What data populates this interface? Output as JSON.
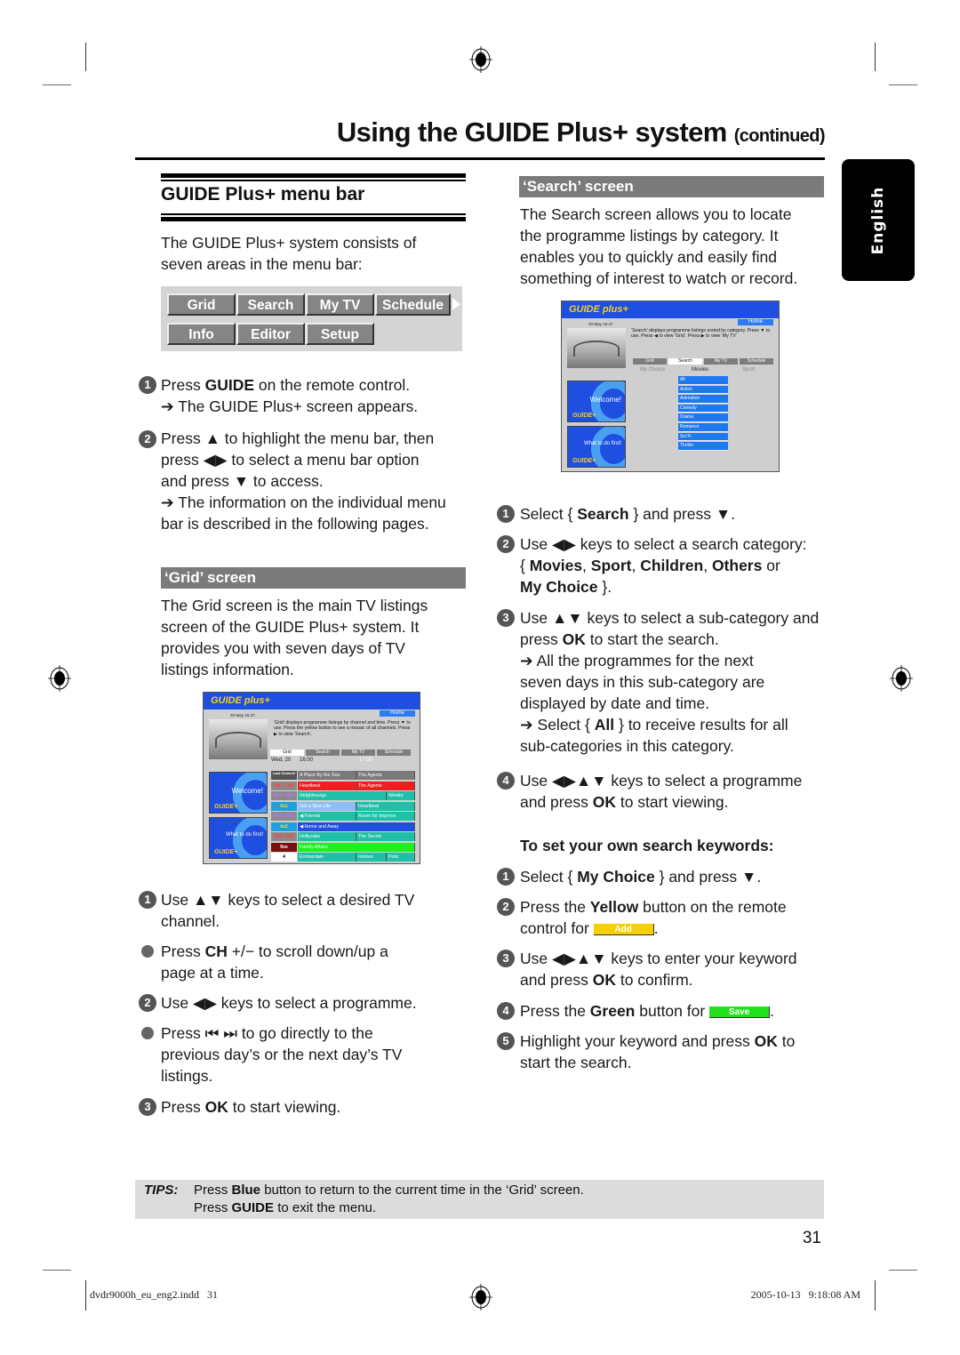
{
  "header": {
    "title": "Using the GUIDE Plus+ system",
    "title_suffix": "(continued)"
  },
  "language_tab": "English",
  "menu_bar_section": {
    "heading": "GUIDE Plus+ menu bar",
    "intro": "The GUIDE Plus+ system consists of seven areas in the menu bar:",
    "menu_buttons_row1": [
      "Grid",
      "Search",
      "My TV",
      "Schedule"
    ],
    "menu_buttons_row2": [
      "Info",
      "Editor",
      "Setup"
    ],
    "steps": [
      {
        "num": "1",
        "parts": [
          "Press ",
          "GUIDE",
          " on the remote control."
        ],
        "result": "The GUIDE Plus+ screen appears."
      },
      {
        "num": "2",
        "line1": "Press ▲ to highlight the menu bar, then",
        "line2": "press ◀▶ to select a menu bar option",
        "line3": "and press ▼ to access.",
        "result_line1": "The information on the individual menu",
        "result_line2": "bar is described in the following pages."
      }
    ]
  },
  "grid_section": {
    "heading": "‘Grid’ screen",
    "description_lines": [
      "The Grid screen is the main TV listings",
      "screen of the GUIDE Plus+ system.  It",
      "provides you with seven days of TV",
      "listings information."
    ],
    "tv_screen": {
      "logo": "GUIDE plus+",
      "home_label": "Home",
      "date_time": "20-May   16:47",
      "description": "‘Grid’ displays programme listings by channel and time.  Press ▼ to use.  Press the yellow button to see a mosaic of all channels.  Press ▶ to view ‘Search’.",
      "tabs": [
        "Grid",
        "Search",
        "My TV",
        "Schedule"
      ],
      "active_tab": "Grid",
      "day": "Wed, 20",
      "time_slots": [
        "16:00",
        "17:00"
      ],
      "panel1_text": "Welcome!",
      "panel2_text": "What to do first!",
      "rows": [
        {
          "channel": "Last Channel",
          "programmes": [
            "A Place By the Sea",
            "The Agents"
          ],
          "color": "#7a7a7a"
        },
        {
          "channel": "BBC ONE",
          "programmes": [
            "Heartbeat",
            "The Agents"
          ],
          "color": "#f01e1e"
        },
        {
          "channel": "BBC TWO",
          "programmes": [
            "Neighbourgs",
            "Weeko"
          ],
          "color": "#20c0a8"
        },
        {
          "channel": "itv1",
          "programmes": [
            "Get a New Life",
            "Heartbeat"
          ],
          "color": "#20c0a8"
        },
        {
          "channel": "BBC TWO",
          "programmes": [
            "◀ Friends",
            "Room for Improve"
          ],
          "color": "#20c0a8"
        },
        {
          "channel": "itv2",
          "programmes": [
            "◀ Home and Away"
          ],
          "color": "#1f4fe0"
        },
        {
          "channel": "BBC ONE",
          "programmes": [
            "Hollyoaks",
            "The Secret"
          ],
          "color": "#20c0a8"
        },
        {
          "channel": "five",
          "programmes": [
            "Family Affairs"
          ],
          "color": "#1ef01e"
        },
        {
          "channel": "4",
          "programmes": [
            "Emmerdale",
            "Homes",
            "Polic"
          ],
          "color": "#20c0a8"
        }
      ]
    },
    "steps": [
      {
        "type": "num",
        "num": "1",
        "line1": "Use ▲▼ keys to select a desired TV",
        "line2": "channel."
      },
      {
        "type": "bullet",
        "line1_pre": "Press ",
        "line1_bold": "CH",
        "line1_post": " +/− to scroll down/up a",
        "line2": "page at a time."
      },
      {
        "type": "num",
        "num": "2",
        "line1": "Use ◀▶ keys to select a programme."
      },
      {
        "type": "bullet",
        "line1": "Press ⏮ ⏭ to go directly to the",
        "line2": "previous day’s or the next day’s TV",
        "line3": "listings."
      },
      {
        "type": "num",
        "num": "3",
        "line1_pre": "Press ",
        "line1_bold": "OK",
        "line1_post": " to start viewing."
      }
    ]
  },
  "search_section": {
    "heading": "‘Search’ screen",
    "description_lines": [
      "The Search screen allows you to locate",
      "the programme listings by category. It",
      "enables you to quickly and easily find",
      "something of interest to watch or record."
    ],
    "tv_screen": {
      "logo": "GUIDE plus+",
      "home_label": "Home",
      "date_time": "20-May   16:47",
      "description": "‘Search’ displays programme listings sorted by category. Press ▼ to use. Press ◀ to view ‘Grid’. Press ▶ to view ‘My TV’",
      "tabs": [
        "Grid",
        "Search",
        "My TV",
        "Schedule"
      ],
      "active_tab": "Search",
      "categories": [
        "My Choice",
        "Movies",
        "Sport"
      ],
      "active_category": "Movies",
      "sub_categories": [
        "All",
        "Action",
        "Animation",
        "Comedy",
        "Drama",
        "Romance",
        "Sci Fi",
        "Thriller"
      ],
      "panel1_text": "Welcome!",
      "panel2_text": "What to do first!"
    },
    "steps": [
      {
        "num": "1",
        "pre": "Select { ",
        "bold": "Search",
        "post": " } and press ▼."
      },
      {
        "num": "2",
        "line1": "Use ◀▶ keys to select a search category:",
        "line2_parts": [
          "{ ",
          "Movies",
          ", ",
          "Sport",
          ", ",
          "Children",
          ", ",
          "Others",
          " or"
        ],
        "line3_parts": [
          "My Choice",
          " }."
        ]
      },
      {
        "num": "3",
        "line1": "Use ▲▼ keys to select a sub-category and",
        "line2_pre": "press ",
        "line2_bold": "OK",
        "line2_post": " to start the search.",
        "result1_line1": "All the programmes for the next",
        "result1_line2": "seven days in this sub-category are",
        "result1_line3": "displayed by date and time.",
        "result2_pre": "Select { ",
        "result2_bold": "All",
        "result2_post": " } to receive results for all",
        "result2_line2": "sub-categories in this category."
      },
      {
        "num": "4",
        "line1": "Use ◀▶▲▼ keys to select a programme",
        "line2_pre": "and press ",
        "line2_bold": "OK",
        "line2_post": " to start viewing."
      }
    ]
  },
  "keywords_section": {
    "heading": "To set your own search keywords:",
    "steps": [
      {
        "num": "1",
        "pre": "Select { ",
        "bold": "My Choice",
        "post": " } and press ▼."
      },
      {
        "num": "2",
        "pre": "Press the ",
        "bold": "Yellow",
        "post": " button on the remote",
        "line2": "control for",
        "button_label": "Add",
        "button_color": "#f5d000"
      },
      {
        "num": "3",
        "line1": "Use ◀▶▲▼ keys to enter your keyword",
        "line2_pre": "and press ",
        "line2_bold": "OK",
        "line2_post": " to confirm."
      },
      {
        "num": "4",
        "pre": "Press the ",
        "bold": "Green",
        "post": " button for",
        "button_label": "Save",
        "button_color": "#22e01e"
      },
      {
        "num": "5",
        "pre": "Highlight your keyword and press ",
        "bold": "OK",
        "post": " to",
        "line2": "start the search."
      }
    ]
  },
  "tips": {
    "label": "TIPS:",
    "line1_pre": "Press ",
    "line1_bold": "Blue",
    "line1_post": " button to return to the current time in the ‘Grid’ screen.",
    "line2_pre": "Press ",
    "line2_bold": "GUIDE",
    "line2_post": " to exit the menu."
  },
  "page_number": "31",
  "footer": {
    "file": "dvdr9000h_eu_eng2.indd   31",
    "timestamp": "2005-10-13   9:18:08 AM"
  }
}
